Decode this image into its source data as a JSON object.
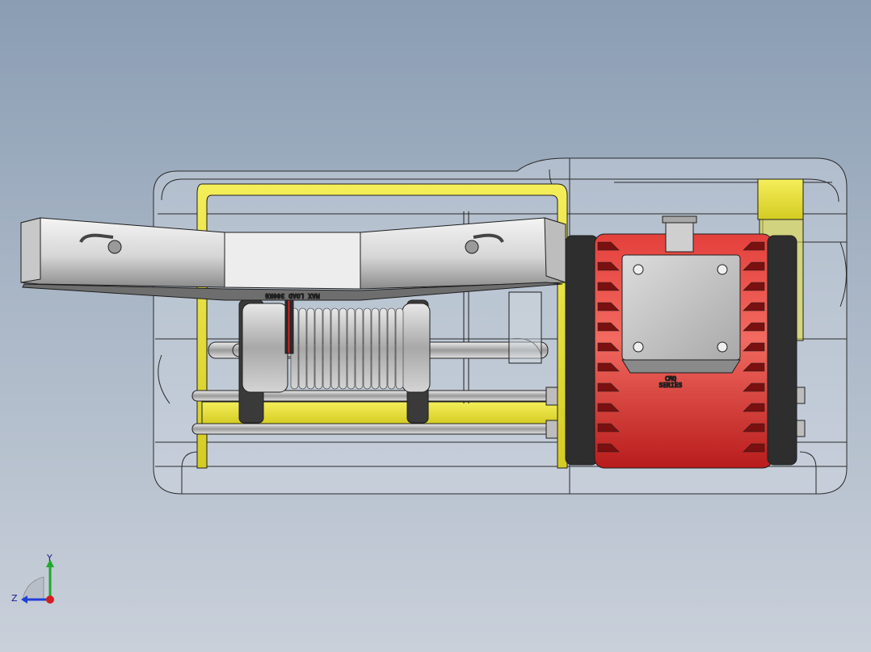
{
  "viewport": {
    "background_top": "#8a9db3",
    "background_bottom": "#c9d0da"
  },
  "model": {
    "description_icon": "electric-winch-cad-model-icon",
    "colors": {
      "frame_yellow": "#e8e23a",
      "motor_red": "#d42a2a",
      "bumper_silver": "#d8d8d8",
      "drum_silver": "#c4c4c4",
      "end_cap_dark": "#3a3a3a",
      "outline": "#1f1f1f"
    },
    "bumper_engraving": "MAX LOAD 300KG",
    "motor_plate_text": "CMQ",
    "motor_plate_text2": "SERIES"
  },
  "triad": {
    "y_label": "Y",
    "z_label": "Z",
    "icon": "coordinate-triad-icon",
    "colors": {
      "y": "#1faa2b",
      "z": "#1f3fd8",
      "x": "#d41e1e"
    }
  }
}
